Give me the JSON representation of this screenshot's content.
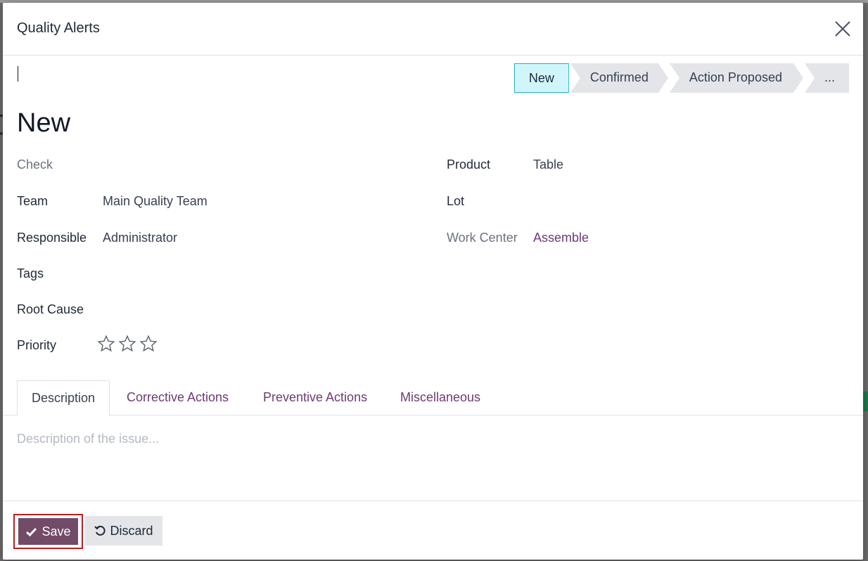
{
  "dialog": {
    "title": "Quality Alerts"
  },
  "statusbar": {
    "stages": [
      "New",
      "Confirmed",
      "Action Proposed",
      "..."
    ],
    "active": "New"
  },
  "record": {
    "title": "New"
  },
  "fields_left": {
    "check_label": "Check",
    "team_label": "Team",
    "team_value": "Main Quality Team",
    "responsible_label": "Responsible",
    "responsible_value": "Administrator",
    "tags_label": "Tags",
    "root_cause_label": "Root Cause",
    "priority_label": "Priority",
    "priority_value": 0,
    "priority_max": 3
  },
  "fields_right": {
    "product_label": "Product",
    "product_value": "Table",
    "lot_label": "Lot",
    "work_center_label": "Work Center",
    "work_center_value": "Assemble"
  },
  "tabs": [
    "Description",
    "Corrective Actions",
    "Preventive Actions",
    "Miscellaneous"
  ],
  "description": {
    "placeholder": "Description of the issue..."
  },
  "footer": {
    "save_label": "Save",
    "discard_label": "Discard"
  },
  "colors": {
    "primary": "#714b67",
    "link": "#6c3b71",
    "active_stage": "#d0f6fb",
    "highlight_border": "#c21c1c"
  }
}
